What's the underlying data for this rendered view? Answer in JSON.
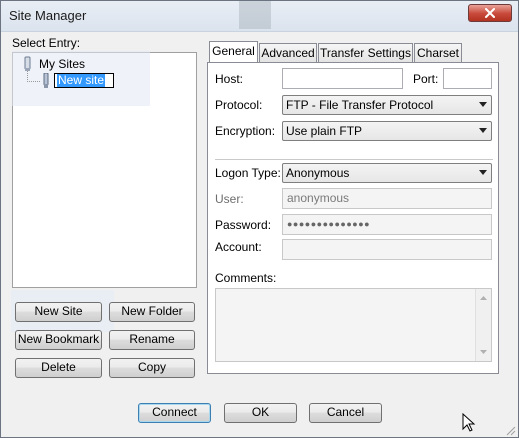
{
  "window": {
    "title": "Site Manager"
  },
  "left": {
    "select_entry_label": "Select Entry:",
    "tree": {
      "root_label": "My Sites",
      "child_label": "New site"
    },
    "buttons": {
      "new_site": "New Site",
      "new_folder": "New Folder",
      "new_bookmark": "New Bookmark",
      "rename": "Rename",
      "delete": "Delete",
      "copy": "Copy"
    }
  },
  "tabs": [
    "General",
    "Advanced",
    "Transfer Settings",
    "Charset"
  ],
  "general": {
    "host_label": "Host:",
    "host_value": "",
    "port_label": "Port:",
    "port_value": "",
    "protocol_label": "Protocol:",
    "protocol_value": "FTP - File Transfer Protocol",
    "encryption_label": "Encryption:",
    "encryption_value": "Use plain FTP",
    "logon_type_label": "Logon Type:",
    "logon_type_value": "Anonymous",
    "user_label": "User:",
    "user_value": "anonymous",
    "password_label": "Password:",
    "password_value": "●●●●●●●●●●●●●●",
    "account_label": "Account:",
    "account_value": "",
    "comments_label": "Comments:",
    "comments_value": ""
  },
  "footer": {
    "connect": "Connect",
    "ok": "OK",
    "cancel": "Cancel"
  }
}
